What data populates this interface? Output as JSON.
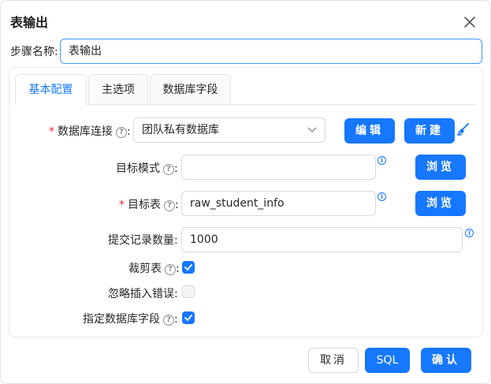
{
  "dialog": {
    "title": "表输出"
  },
  "step": {
    "label": "步骤名称",
    "value": "表输出"
  },
  "tabs": [
    {
      "label": "基本配置"
    },
    {
      "label": "主选项"
    },
    {
      "label": "数据库字段"
    }
  ],
  "form": {
    "connection": {
      "label": "数据库连接",
      "value": "团队私有数据库",
      "edit_label": "编辑",
      "new_label": "新建"
    },
    "schema": {
      "label": "目标模式",
      "value": "",
      "browse_label": "浏览"
    },
    "table": {
      "label": "目标表",
      "value": "raw_student_info",
      "browse_label": "浏览"
    },
    "commit": {
      "label": "提交记录数量",
      "value": "1000"
    },
    "truncate": {
      "label": "裁剪表",
      "checked": true
    },
    "ignore_errors": {
      "label": "忽略插入错误",
      "checked": false
    },
    "specify_fields": {
      "label": "指定数据库字段",
      "checked": true
    }
  },
  "footer": {
    "cancel_label": "取消",
    "sql_label": "SQL",
    "ok_label": "确认"
  },
  "colors": {
    "primary": "#1677ff",
    "required": "#f5222d",
    "focus_border": "#4096ff"
  },
  "icons": {
    "close": "close-icon",
    "help": "help-circle-icon",
    "info": "info-circle-icon",
    "broom": "broom-icon",
    "dropdown": "chevron-down-icon",
    "check": "check-icon"
  }
}
